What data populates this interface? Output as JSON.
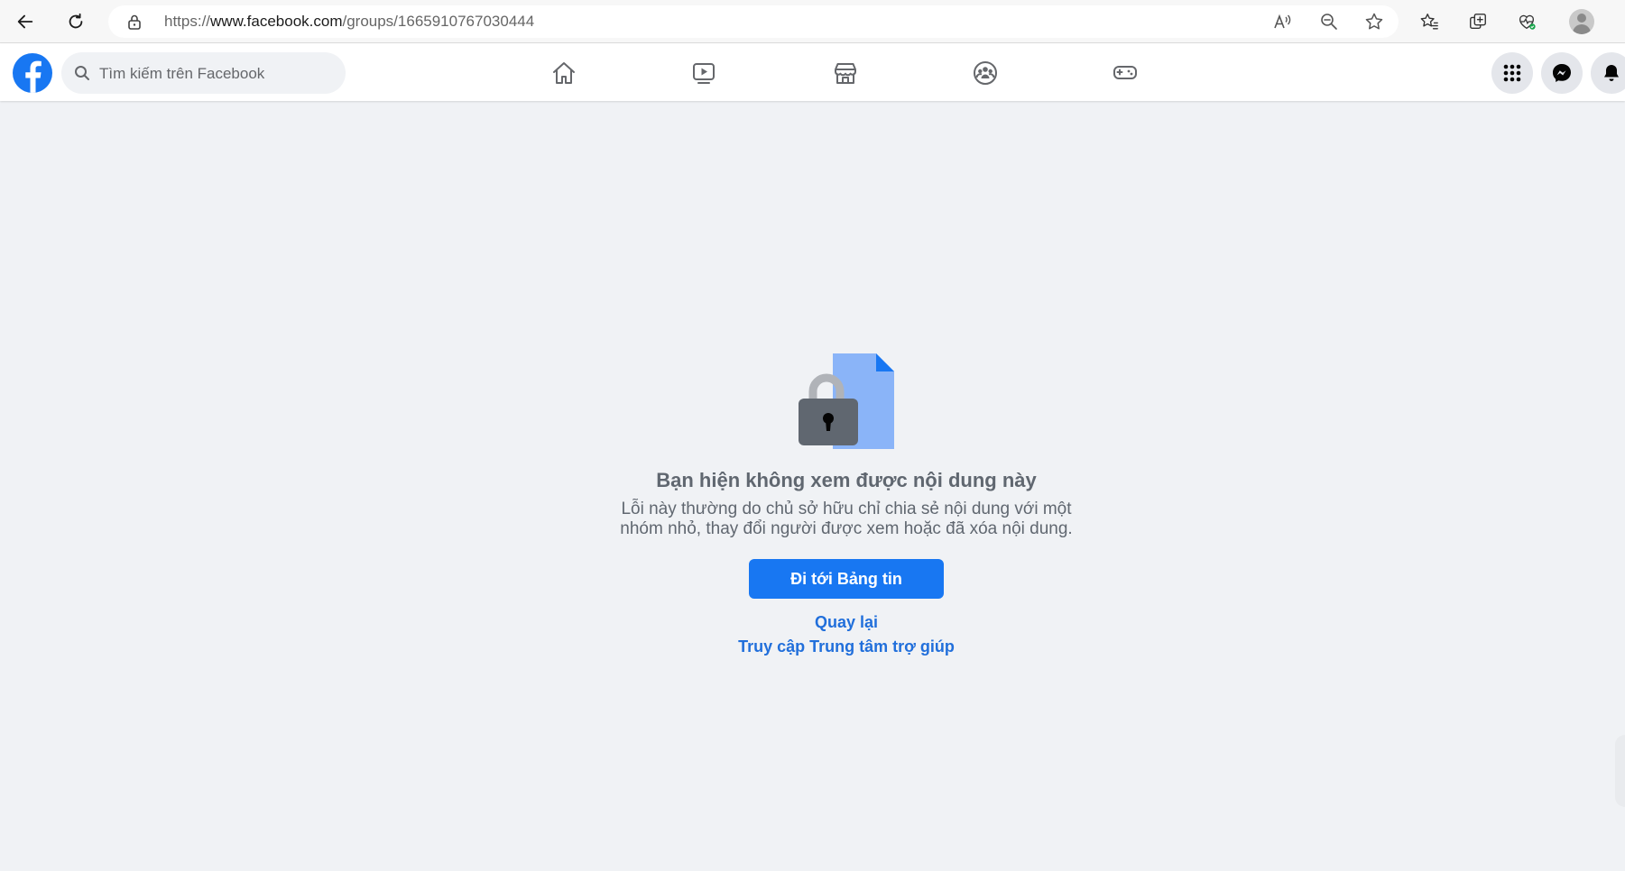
{
  "browser": {
    "url_prefix": "https://",
    "url_host": "www.facebook.com",
    "url_path": "/groups/1665910767030444",
    "icons": [
      "back-icon",
      "refresh-icon",
      "lock-icon",
      "read-aloud-icon",
      "zoom-out-icon",
      "favorite-star-icon",
      "favorites-icon",
      "collections-icon",
      "browser-essentials-icon",
      "profile-icon"
    ]
  },
  "header": {
    "search_placeholder": "Tìm kiếm trên Facebook",
    "nav_tabs": [
      "home",
      "watch",
      "marketplace",
      "groups",
      "gaming"
    ],
    "actions": [
      "menu",
      "messenger",
      "notifications"
    ]
  },
  "main": {
    "title": "Bạn hiện không xem được nội dung này",
    "description_line1": "Lỗi này thường do chủ sở hữu chỉ chia sẻ nội dung với một",
    "description_line2": "nhóm nhỏ, thay đổi người được xem hoặc đã xóa nội dung.",
    "primary_button": "Đi tới Bảng tin",
    "back_link": "Quay lại",
    "help_link": "Truy cập Trung tâm trợ giúp"
  },
  "colors": {
    "brand": "#1877f2",
    "link": "#216fdb",
    "page_bg": "#f0f2f5",
    "muted_text": "#606770"
  }
}
